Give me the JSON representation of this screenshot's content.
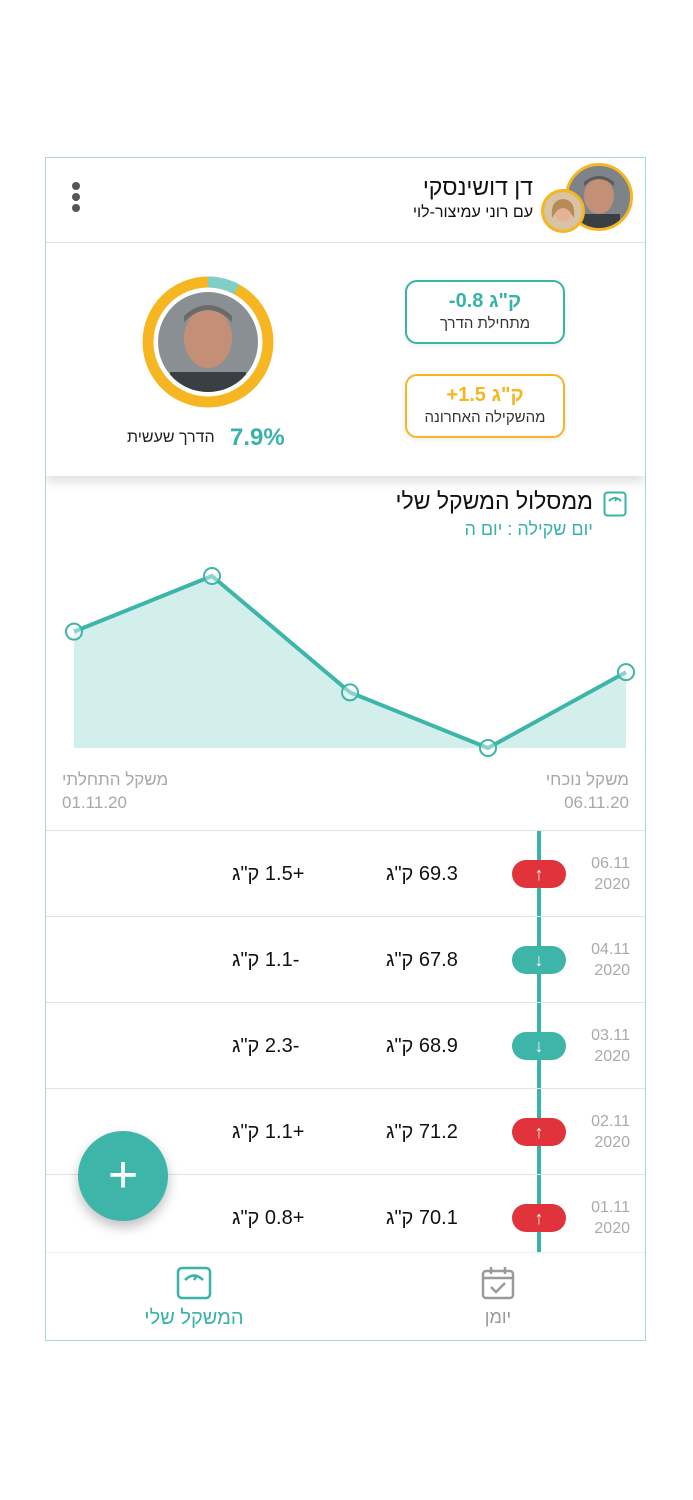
{
  "header": {
    "user_name": "דן דושינסקי",
    "coach_line": "עם רוני עמיצור-לוי"
  },
  "summary": {
    "progress_percent": "7.9%",
    "progress_fraction": 0.079,
    "progress_label": "הדרך שעשית",
    "from_start": {
      "value": "-0.8 ק\"ג",
      "label": "מתחילת הדרך"
    },
    "from_last": {
      "value": "+1.5 ק\"ג",
      "label": "מהשקילה האחרונה"
    }
  },
  "chart_section": {
    "title": "ממסלול המשקל שלי",
    "weigh_day": "יום שקילה : יום ה",
    "current_label": "משקל נוכחי",
    "current_date": "06.11.20",
    "initial_label": "משקל התחלתי",
    "initial_date": "01.11.20"
  },
  "chart_data": {
    "type": "area",
    "x": [
      "01.11",
      "02.11",
      "03.11",
      "04.11",
      "06.11"
    ],
    "values": [
      70.1,
      71.2,
      68.9,
      67.8,
      69.3
    ],
    "ylim": [
      67.8,
      71.2
    ],
    "x_direction": "right-to-left",
    "grid": false,
    "line_color": "#3db5a9",
    "fill_color": "#d3efec"
  },
  "history": [
    {
      "date": "06.11",
      "year": "2020",
      "direction": "up",
      "weight": "69.3 ק\"ג",
      "diff": "+1.5 ק\"ג"
    },
    {
      "date": "04.11",
      "year": "2020",
      "direction": "down",
      "weight": "67.8 ק\"ג",
      "diff": "-1.1 ק\"ג"
    },
    {
      "date": "03.11",
      "year": "2020",
      "direction": "down",
      "weight": "68.9 ק\"ג",
      "diff": "-2.3 ק\"ג"
    },
    {
      "date": "02.11",
      "year": "2020",
      "direction": "up",
      "weight": "71.2 ק\"ג",
      "diff": "+1.1 ק\"ג"
    },
    {
      "date": "01.11",
      "year": "2020",
      "direction": "up",
      "weight": "70.1 ק\"ג",
      "diff": "+0.8 ק\"ג"
    }
  ],
  "fab": {
    "icon": "+"
  },
  "nav": {
    "my_weight": "המשקל שלי",
    "diary": "יומן"
  },
  "colors": {
    "teal": "#38b3a8",
    "yellow": "#f5b621",
    "red": "#e0333b"
  },
  "icons": {
    "menu": "more-vertical-icon",
    "scale": "scale-icon",
    "calendar": "calendar-check-icon",
    "up": "arrow-up-icon",
    "down": "arrow-down-icon"
  }
}
